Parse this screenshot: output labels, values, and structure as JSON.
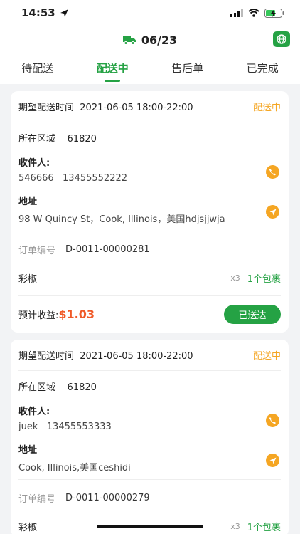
{
  "status_bar": {
    "time": "14:53"
  },
  "header": {
    "date": "06/23"
  },
  "tabs": [
    "待配送",
    "配送中",
    "售后单",
    "已完成"
  ],
  "colors": {
    "accent": "#25a244",
    "status": "#f5a623",
    "amount": "#f05a28"
  },
  "orders": [
    {
      "expected_label": "期望配送时间",
      "expected_time": "2021-06-05 18:00-22:00",
      "status": "配送中",
      "region_label": "所在区域",
      "region": "61820",
      "recipient_label": "收件人:",
      "recipient": "546666   13455552222",
      "address_label": "地址",
      "address": "98 W Quincy St，Cook, Illinois，美国hdjsjjwja",
      "order_label": "订单编号",
      "order_no": "D-0011-00000281",
      "item": "彩椒",
      "qty": "x3",
      "packages": "1个包裹",
      "income_label": "预计收益:",
      "income": "$1.03",
      "button": "已送达"
    },
    {
      "expected_label": "期望配送时间",
      "expected_time": "2021-06-05 18:00-22:00",
      "status": "配送中",
      "region_label": "所在区域",
      "region": "61820",
      "recipient_label": "收件人:",
      "recipient": "juek   13455553333",
      "address_label": "地址",
      "address": "Cook, Illinois,美国ceshidi",
      "order_label": "订单编号",
      "order_no": "D-0011-00000279",
      "item": "彩椒",
      "qty": "x3",
      "packages": "1个包裹"
    }
  ]
}
